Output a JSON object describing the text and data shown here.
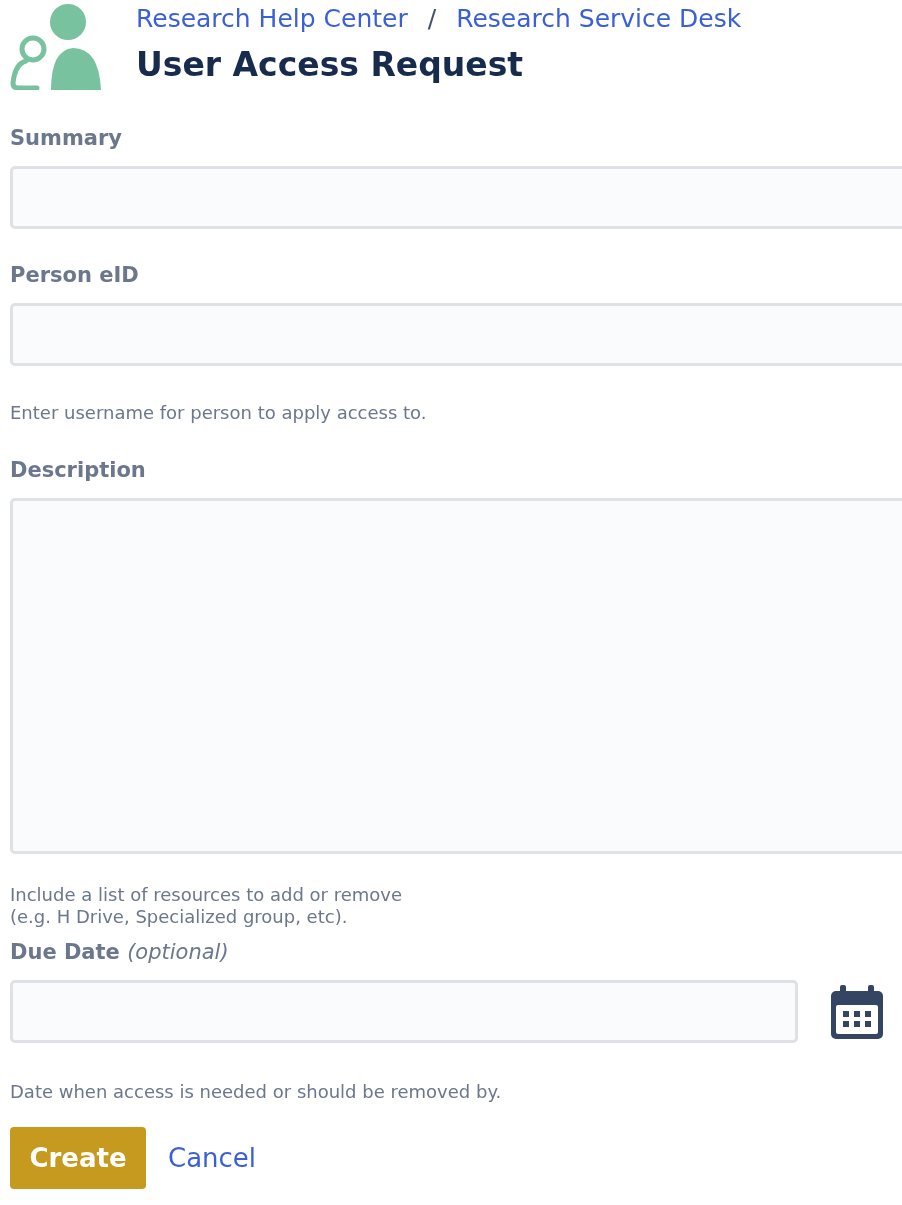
{
  "breadcrumbs": [
    {
      "label": "Research Help Center"
    },
    {
      "label": "Research Service Desk"
    }
  ],
  "breadcrumb_separator": "/",
  "title": "User Access Request",
  "fields": [
    {
      "kind": "text",
      "label": "Summary"
    },
    {
      "kind": "text",
      "label": "Person eID",
      "help": [
        "Enter username for person to apply access to."
      ]
    },
    {
      "kind": "textarea",
      "label": "Description",
      "help": [
        "Include a list of resources to add or remove",
        "(e.g. H Drive, Specialized group, etc)."
      ]
    },
    {
      "kind": "date",
      "label": "Due Date",
      "optional_note": "(optional)",
      "help": [
        "Date when access is needed or should be removed by."
      ]
    }
  ],
  "buttons": {
    "submit": "Create",
    "cancel": "Cancel"
  }
}
